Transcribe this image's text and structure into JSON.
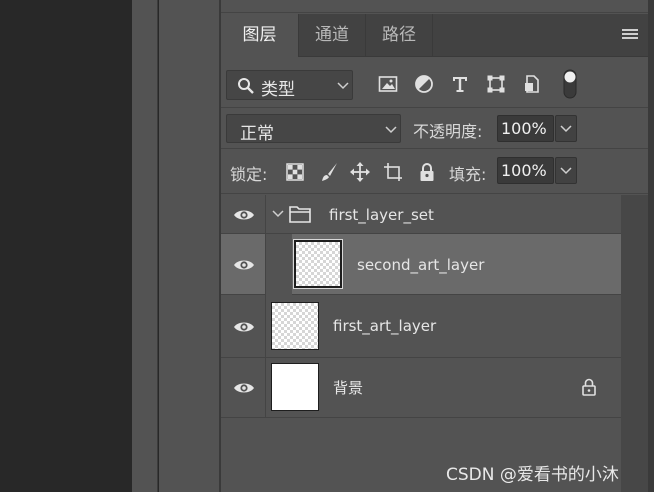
{
  "tabs": [
    {
      "label": "图层",
      "active": true
    },
    {
      "label": "通道",
      "active": false
    },
    {
      "label": "路径",
      "active": false
    }
  ],
  "filter": {
    "kind_label": "类型",
    "icons": [
      "image-filter-icon",
      "adjustment-filter-icon",
      "type-filter-icon",
      "shape-filter-icon",
      "smart-object-filter-icon",
      "filter-toggle-icon"
    ]
  },
  "blend": {
    "mode": "正常",
    "opacity_label": "不透明度:",
    "opacity_value": "100%"
  },
  "lock": {
    "label": "锁定:",
    "fill_label": "填充:",
    "fill_value": "100%"
  },
  "layers": [
    {
      "name": "first_layer_set",
      "type": "group",
      "expanded": true,
      "visible": true
    },
    {
      "name": "second_art_layer",
      "type": "art",
      "selected": true,
      "visible": true,
      "indent": 1
    },
    {
      "name": "first_art_layer",
      "type": "art",
      "selected": false,
      "visible": true
    },
    {
      "name": "背景",
      "type": "background",
      "locked": true,
      "visible": true
    }
  ],
  "watermark": "CSDN @爱看书的小沐",
  "colors": {
    "panel_bg": "#535353",
    "tabbar_bg": "#424242",
    "selected_row": "#6a6a6a",
    "workspace_bg": "#282828"
  }
}
